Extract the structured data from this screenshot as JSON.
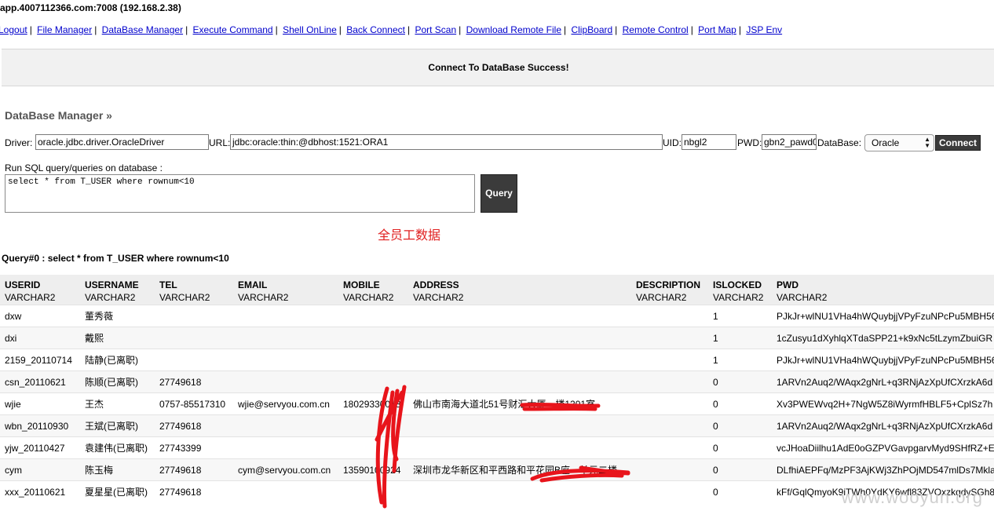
{
  "window": {
    "title": "app.4007112366.com:7008 (192.168.2.38)"
  },
  "nav": {
    "links": [
      "Logout",
      "File Manager",
      "DataBase Manager",
      "Execute Command",
      "Shell OnLine",
      "Back Connect",
      "Port Scan",
      "Download Remote File",
      "ClipBoard",
      "Remote Control",
      "Port Map",
      "JSP Env"
    ],
    "separator": "|"
  },
  "message": "Connect To DataBase Success!",
  "db_manager": {
    "title": "DataBase Manager »",
    "driver_label": "Driver:",
    "driver_value": "oracle.jdbc.driver.OracleDriver",
    "url_label": "URL:",
    "url_value": "jdbc:oracle:thin:@dbhost:1521:ORA1",
    "uid_label": "UID:",
    "uid_value": "nbgl2",
    "pwd_label": "PWD:",
    "pwd_value": "gbn2_pawd0",
    "database_label": "DataBase:",
    "database_selected": "Oracle",
    "connect_label": "Connect"
  },
  "sql": {
    "label": "Run SQL query/queries on database :",
    "value": "select * from T_USER where rownum<10",
    "query_button": "Query"
  },
  "annotation": "全员工数据",
  "result": {
    "heading": "Query#0 : select * from T_USER where rownum<10",
    "columns": [
      {
        "name": "USERID",
        "type": "VARCHAR2"
      },
      {
        "name": "USERNAME",
        "type": "VARCHAR2"
      },
      {
        "name": "TEL",
        "type": "VARCHAR2"
      },
      {
        "name": "EMAIL",
        "type": "VARCHAR2"
      },
      {
        "name": "MOBILE",
        "type": "VARCHAR2"
      },
      {
        "name": "ADDRESS",
        "type": "VARCHAR2"
      },
      {
        "name": "DESCRIPTION",
        "type": "VARCHAR2"
      },
      {
        "name": "ISLOCKED",
        "type": "VARCHAR2"
      },
      {
        "name": "PWD",
        "type": "VARCHAR2"
      }
    ],
    "rows": [
      [
        "dxw",
        "董秀薇",
        "",
        "",
        "",
        "",
        "",
        "1",
        "PJkJr+wlNU1VHa4hWQuybjjVPyFzuNPcPu5MBH56"
      ],
      [
        "dxi",
        "戴熙",
        "",
        "",
        "",
        "",
        "",
        "1",
        "1cZusyu1dXyhlqXTdaSPP21+k9xNc5tLzymZbuiGR"
      ],
      [
        "2159_20110714",
        "陆静(已离职)",
        "",
        "",
        "",
        "",
        "",
        "1",
        "PJkJr+wlNU1VHa4hWQuybjjVPyFzuNPcPu5MBH56"
      ],
      [
        "csn_20110621",
        "陈顺(已离职)",
        "27749618",
        "",
        "",
        "",
        "",
        "0",
        "1ARVn2Auq2/WAqx2gNrL+q3RNjAzXpUfCXrzkA6d"
      ],
      [
        "wjie",
        "王杰",
        "0757-85517310",
        "wjie@servyou.com.cn",
        "18029330018",
        "佛山市南海大道北51号财汇大厦一楼1201室",
        "",
        "0",
        "Xv3PWEWvq2H+7NgW5Z8iWyrmfHBLF5+CplSz7h"
      ],
      [
        "wbn_20110930",
        "王斌(已离职)",
        "27749618",
        "",
        "",
        "",
        "",
        "0",
        "1ARVn2Auq2/WAqx2gNrL+q3RNjAzXpUfCXrzkA6d"
      ],
      [
        "yjw_20110427",
        "袁建伟(已离职)",
        "27743399",
        "",
        "",
        "",
        "",
        "0",
        "vcJHoaDiilhu1AdE0oGZPVGavpgarvMyd9SHfRZ+E"
      ],
      [
        "cym",
        "陈玉梅",
        "27749618",
        "cym@servyou.com.cn",
        "13590100924",
        "深圳市龙华新区和平西路和平花园B座一单元二楼",
        "",
        "0",
        "DLfhiAEPFq/MzPF3AjKWj3ZhPOjMD547mlDs7Mkla"
      ],
      [
        "xxx_20110621",
        "夏星星(已离职)",
        "27749618",
        "",
        "",
        "",
        "",
        "0",
        "kFf/GqlQmyoK9iTWh0YdKY6wfl83ZVOxzkqdySGh8"
      ]
    ]
  },
  "watermark": "www.wooyun.org",
  "colors": {
    "link": "#0000cc",
    "annotation": "#e02020",
    "button": "#3b3b3b"
  }
}
